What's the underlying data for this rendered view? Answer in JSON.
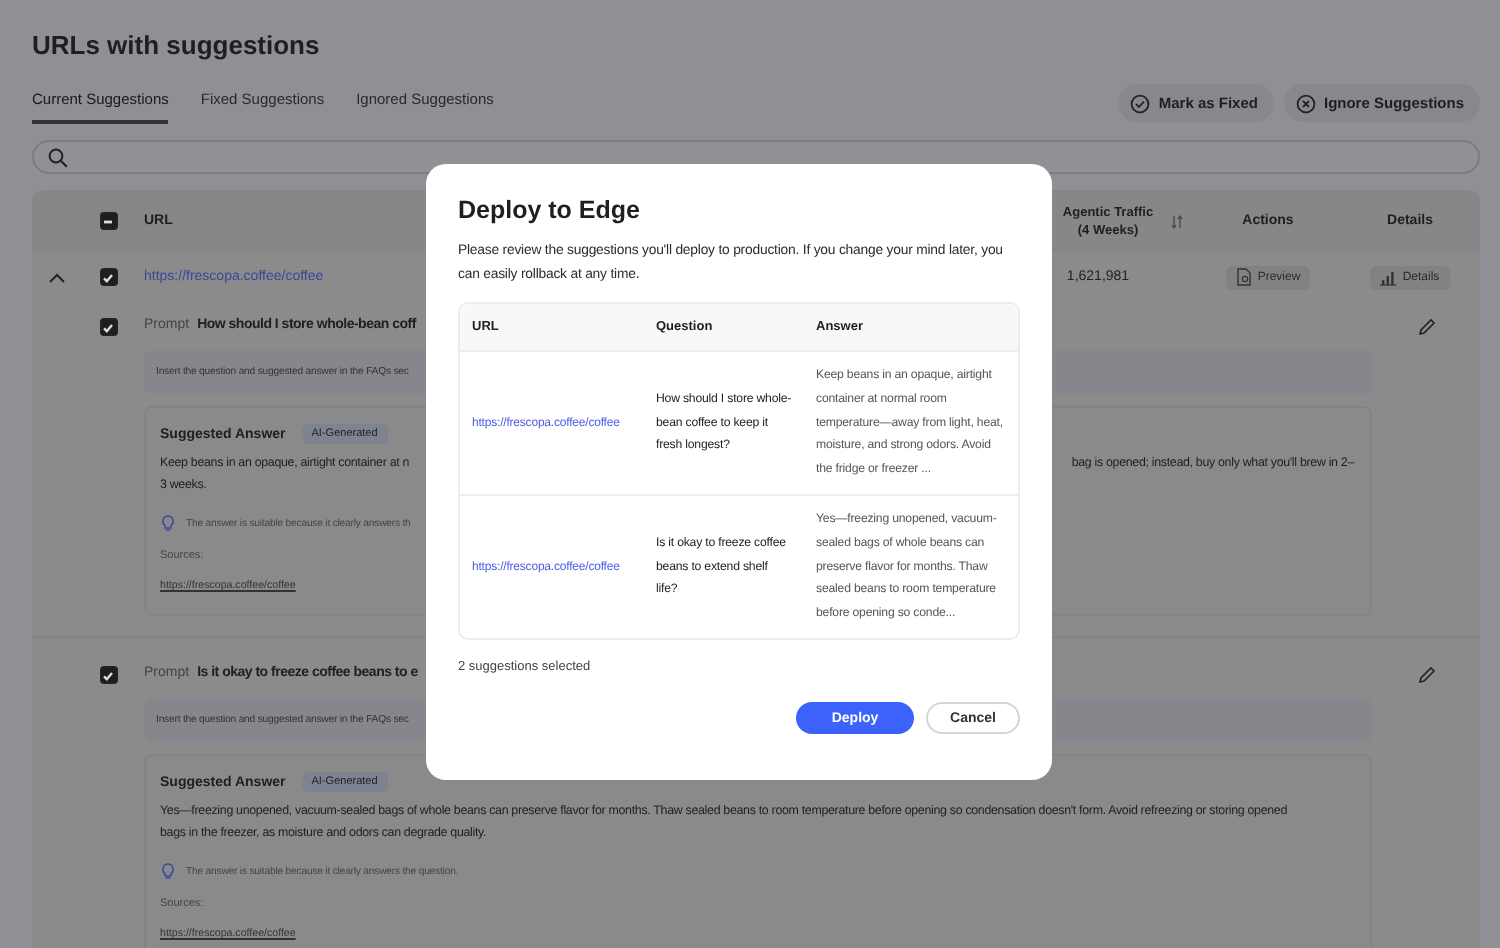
{
  "page": {
    "title": "URLs with suggestions"
  },
  "tabs": [
    {
      "label": "Current Suggestions",
      "selected": true
    },
    {
      "label": "Fixed Suggestions",
      "selected": false
    },
    {
      "label": "Ignored Suggestions",
      "selected": false
    }
  ],
  "actions": [
    {
      "label": "Mark as Fixed",
      "kind": "fix"
    },
    {
      "label": "Ignore Suggestions",
      "kind": "ignore"
    }
  ],
  "table": {
    "select_all": {
      "indeterminate": true
    },
    "columns": [
      {
        "label": "URL",
        "kind": "url"
      },
      {
        "label": "Agentic Traffic (4 Weeks)",
        "kind": "traffic",
        "sortable": true
      },
      {
        "label": "Actions",
        "kind": "actions"
      },
      {
        "label": "Details",
        "kind": "details"
      }
    ],
    "rows": [
      {
        "expanded": true,
        "checked": true,
        "url": "https://frescopa.coffee/coffee",
        "traffic": "1,621,981",
        "preview": "Preview",
        "details": "Details",
        "suggestions": [
          {
            "checked": true,
            "prompt_label": "Prompt",
            "question": "How should I store whole-bean coff",
            "instruction": "Insert the question and suggested answer in the FAQs sec",
            "answer_title": "Suggested Answer",
            "badge": "AI-Generated",
            "answer_lines": [
              [
                "Keep beans in an opaque, airtight container at n",
                "bag is opened; instead, buy only what you'll brew in 2–"
              ],
              [
                "3 weeks."
              ]
            ],
            "reason": "The answer is suitable because it clearly answers th",
            "sources_label": "Sources:",
            "source": "https://frescopa.coffee/coffee"
          },
          {
            "checked": true,
            "prompt_label": "Prompt",
            "question": "Is it okay to freeze coffee beans to e",
            "instruction": "Insert the question and suggested answer in the FAQs sec",
            "answer_title": "Suggested Answer",
            "badge": "AI-Generated",
            "answer_lines": [
              [
                "Yes—freezing unopened, vacuum-sealed bags of whole beans can preserve flavor for months. Thaw sealed beans to room temperature before opening so condensation doesn't form. Avoid refreezing or storing opened"
              ],
              [
                "bags in the freezer, as moisture and odors can degrade quality."
              ]
            ],
            "reason": "The answer is suitable because it clearly answers the question.",
            "sources_label": "Sources:",
            "source": "https://frescopa.coffee/coffee"
          }
        ]
      }
    ]
  },
  "dialog": {
    "title": "Deploy to Edge",
    "description": "Please review the suggestions you'll deploy to production. If you change your mind later, you can easily rollback at any time.",
    "columns": [
      "URL",
      "Question",
      "Answer"
    ],
    "rows": [
      {
        "url": "https://frescopa.coffee/coffee",
        "question": "How should I store whole-bean coffee to keep it fresh longest?",
        "answer": "Keep beans in an opaque, airtight container at normal room temperature—away from light, heat, moisture, and strong odors. Avoid the fridge or freezer ..."
      },
      {
        "url": "https://frescopa.coffee/coffee",
        "question": "Is it okay to freeze coffee beans to extend shelf life?",
        "answer": "Yes—freezing unopened, vacuum-sealed bags of whole beans can preserve flavor for months. Thaw sealed beans to room temperature before opening so conde..."
      }
    ],
    "selection_count": "2 suggestions selected",
    "buttons": [
      {
        "label": "Deploy",
        "kind": "primary"
      },
      {
        "label": "Cancel",
        "kind": "secondary"
      }
    ]
  }
}
